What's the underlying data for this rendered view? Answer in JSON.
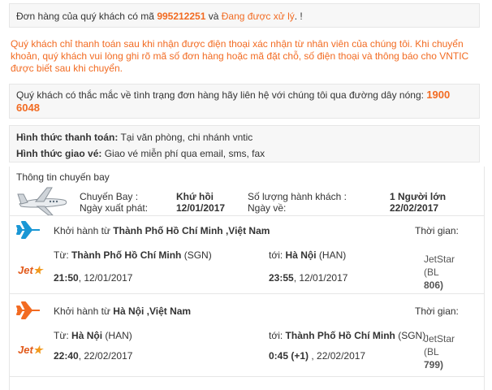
{
  "order_status": {
    "prefix": "Đơn hàng của quý khách có mã",
    "order_code": "995212251",
    "and": "và",
    "status": "Đang được xử lý",
    "suffix": ". !"
  },
  "notice": "Quý khách chỉ thanh toán sau khi nhận được điện thoại xác nhận từ nhân viên của chúng tôi. Khi chuyển khoản, quý khách vui lòng ghi rõ mã số đơn hàng hoặc mã đặt chỗ, số điện thoại và thông báo cho VNTIC được biết sau khi chuyển.",
  "hotline_box": {
    "text": "Quý khách có thắc mắc về tình trạng đơn hàng hãy liên hệ với chúng tôi qua đường dây nóng:",
    "number": "1900 6048"
  },
  "payment": {
    "payment_label": "Hình thức thanh toán:",
    "payment_value": "Tại văn phòng, chi nhánh vntic",
    "delivery_label": "Hình thức giao vé:",
    "delivery_value": "Giao vé miễn phí qua email, sms, fax"
  },
  "flight_info": {
    "title": "Thông tin chuyến bay",
    "trip_label": "Chuyến Bay :",
    "trip_value": "Khứ hồi",
    "passengers_label": "Số lượng hành khách :",
    "passengers_value": "1 Người lớn",
    "depart_label": "Ngày xuất phát:",
    "depart_value": "12/01/2017",
    "return_label": "Ngày về:",
    "return_value": "22/02/2017"
  },
  "legs": [
    {
      "header_prefix": "Khởi hành từ",
      "header_place": "Thành Phố Hồ Chí Minh ,Việt Nam",
      "time_label": "Thời gian:",
      "from_label": "Từ:",
      "from_city": "Thành Phố Hồ Chí Minh",
      "from_code": "(SGN)",
      "to_label": "tới:",
      "to_city": "Hà Nội",
      "to_code": "(HAN)",
      "dep_time": "21:50",
      "dep_date": ", 12/01/2017",
      "arr_time": "23:55",
      "arr_date": ", 12/01/2017",
      "airline": "JetStar",
      "flight_code": "(BL",
      "flight_num": "806)",
      "plane_color": "#1a97d5"
    },
    {
      "header_prefix": "Khởi hành từ",
      "header_place": "Hà Nội ,Việt Nam",
      "time_label": "Thời gian:",
      "from_label": "Từ:",
      "from_city": "Hà Nội",
      "from_code": "(HAN)",
      "to_label": "tới:",
      "to_city": "Thành Phố Hồ Chí Minh",
      "to_code": "(SGN)",
      "dep_time": "22:40",
      "dep_date": ", 22/02/2017",
      "arr_time": "0:45 (+1)",
      "arr_date": " , 22/02/2017",
      "airline": "JetStar",
      "flight_code": "(BL",
      "flight_num": "799)",
      "plane_color": "#f26b22"
    }
  ],
  "logo_text": "Jet",
  "icons": {
    "jet": "private-jet-icon",
    "plane": "airplane-icon",
    "logo": "jetstar-logo-icon"
  }
}
